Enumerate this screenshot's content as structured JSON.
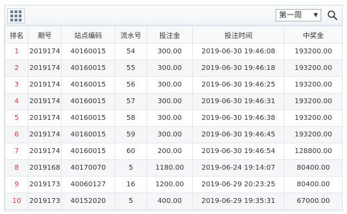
{
  "toolbar": {
    "period_select": "第一周"
  },
  "table": {
    "headers": [
      "排名",
      "期号",
      "站点编码",
      "流水号",
      "投注金",
      "投注时间",
      "中奖金"
    ],
    "rows": [
      [
        "1",
        "2019174",
        "40160015",
        "54",
        "300.00",
        "2019-06-30 19:46:08",
        "193200.00"
      ],
      [
        "2",
        "2019174",
        "40160015",
        "55",
        "300.00",
        "2019-06-30 19:46:18",
        "193200.00"
      ],
      [
        "3",
        "2019174",
        "40160015",
        "56",
        "300.00",
        "2019-06-30 19:46:25",
        "193200.00"
      ],
      [
        "4",
        "2019174",
        "40160015",
        "57",
        "300.00",
        "2019-06-30 19:46:31",
        "193200.00"
      ],
      [
        "5",
        "2019174",
        "40160015",
        "58",
        "300.00",
        "2019-06-30 19:46:38",
        "193200.00"
      ],
      [
        "6",
        "2019174",
        "40160015",
        "59",
        "300.00",
        "2019-06-30 19:46:45",
        "193200.00"
      ],
      [
        "7",
        "2019174",
        "40160015",
        "60",
        "200.00",
        "2019-06-30 19:46:54",
        "128800.00"
      ],
      [
        "8",
        "2019168",
        "40170070",
        "5",
        "1180.00",
        "2019-06-24 19:14:07",
        "80400.00"
      ],
      [
        "9",
        "2019173",
        "40060127",
        "16",
        "1200.00",
        "2019-06-29 20:23:25",
        "80400.00"
      ],
      [
        "10",
        "2019173",
        "40152020",
        "5",
        "400.00",
        "2019-06-29 19:35:31",
        "67000.00"
      ]
    ]
  },
  "colors": {
    "rank": "#d43a3a",
    "border": "#d6dde5",
    "alt_row": "#f5f6f7"
  }
}
